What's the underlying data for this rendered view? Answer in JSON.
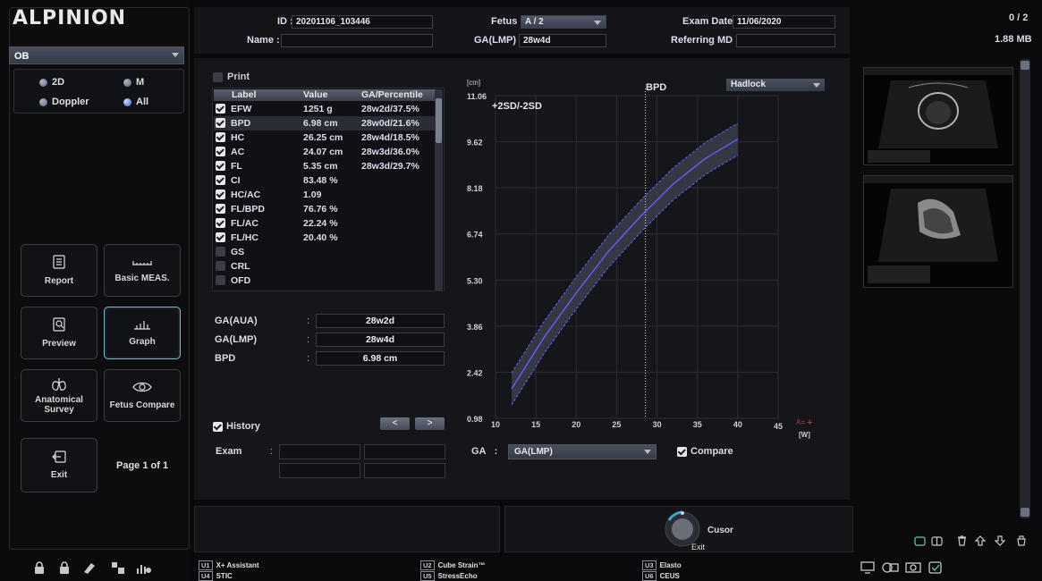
{
  "brand": "ALPINION",
  "app_selector": {
    "value": "OB"
  },
  "modes": [
    {
      "label": "2D",
      "on": false
    },
    {
      "label": "M",
      "on": false
    },
    {
      "label": "Doppler",
      "on": false
    },
    {
      "label": "All",
      "on": true
    }
  ],
  "tools": [
    {
      "label": "Report",
      "icon": "report-icon",
      "active": false
    },
    {
      "label": "Basic MEAS.",
      "icon": "ruler-icon",
      "active": false
    },
    {
      "label": "Preview",
      "icon": "preview-icon",
      "active": false
    },
    {
      "label": "Graph",
      "icon": "graph-icon",
      "active": true
    },
    {
      "label": "Anatomical Survey",
      "icon": "lungs-icon",
      "active": false
    },
    {
      "label": "Fetus Compare",
      "icon": "fetus-icon",
      "active": false
    }
  ],
  "exit_label": "Exit",
  "page_label": "Page 1 of 1",
  "header": {
    "id_label": "ID :",
    "id_value": "20201106_103446",
    "name_label": "Name :",
    "name_value": "",
    "fetus_label": "Fetus :",
    "fetus_value": "A / 2",
    "galmp_label": "GA(LMP) :",
    "galmp_value": "28w4d",
    "exam_date_label": "Exam Date :",
    "exam_date_value": "11/06/2020",
    "ref_md_label": "Referring MD :",
    "ref_md_value": ""
  },
  "print_label": "Print",
  "table": {
    "headers": [
      "Label",
      "Value",
      "GA/Percentile"
    ],
    "rows": [
      {
        "label": "EFW",
        "value": "1251 g",
        "ga": "28w2d/37.5%",
        "checked": true
      },
      {
        "label": "BPD",
        "value": "6.98 cm",
        "ga": "28w0d/21.6%",
        "checked": true
      },
      {
        "label": "HC",
        "value": "26.25 cm",
        "ga": "28w4d/18.5%",
        "checked": true
      },
      {
        "label": "AC",
        "value": "24.07 cm",
        "ga": "28w3d/36.0%",
        "checked": true
      },
      {
        "label": "FL",
        "value": "5.35 cm",
        "ga": "28w3d/29.7%",
        "checked": true
      },
      {
        "label": "CI",
        "value": "83.48 %",
        "ga": "",
        "checked": true
      },
      {
        "label": "HC/AC",
        "value": "1.09",
        "ga": "",
        "checked": true
      },
      {
        "label": "FL/BPD",
        "value": "76.76 %",
        "ga": "",
        "checked": true
      },
      {
        "label": "FL/AC",
        "value": "22.24 %",
        "ga": "",
        "checked": true
      },
      {
        "label": "FL/HC",
        "value": "20.40 %",
        "ga": "",
        "checked": true
      },
      {
        "label": "GS",
        "value": "",
        "ga": "",
        "checked": false
      },
      {
        "label": "CRL",
        "value": "",
        "ga": "",
        "checked": false
      },
      {
        "label": "OFD",
        "value": "",
        "ga": "",
        "checked": false
      }
    ]
  },
  "summary": [
    {
      "label": "GA(AUA)",
      "value": "28w2d"
    },
    {
      "label": "GA(LMP)",
      "value": "28w4d"
    },
    {
      "label": "BPD",
      "value": "6.98 cm"
    }
  ],
  "history_label": "History",
  "nav_prev": "<",
  "nav_next": ">",
  "exam_label": "Exam",
  "ga_label": "GA",
  "ga_select": "GA(LMP)",
  "compare_label": "Compare",
  "chart_data": {
    "type": "line",
    "title": "BPD",
    "method": "Hadlock",
    "band_label": "+2SD/-2SD",
    "ylabel": "[cm]",
    "xlabel": "[W]",
    "xlim": [
      10,
      45
    ],
    "ylim": [
      0.98,
      11.06
    ],
    "yticks": [
      "11.06",
      "9.62",
      "8.18",
      "6.74",
      "5.30",
      "3.86",
      "2.42",
      "0.98"
    ],
    "xticks": [
      "10",
      "15",
      "20",
      "25",
      "30",
      "35",
      "40",
      "45"
    ],
    "marker_label": "A=",
    "marker_x": 28.57,
    "series": [
      {
        "name": "mean",
        "x": [
          12,
          16,
          20,
          24,
          28,
          32,
          36,
          40
        ],
        "values": [
          1.9,
          3.5,
          4.9,
          6.2,
          7.3,
          8.3,
          9.1,
          9.7
        ]
      },
      {
        "name": "+2SD",
        "x": [
          12,
          16,
          20,
          24,
          28,
          32,
          36,
          40
        ],
        "values": [
          2.4,
          4.0,
          5.4,
          6.7,
          7.8,
          8.8,
          9.6,
          10.2
        ]
      },
      {
        "name": "-2SD",
        "x": [
          12,
          16,
          20,
          24,
          28,
          32,
          36,
          40
        ],
        "values": [
          1.4,
          3.0,
          4.4,
          5.7,
          6.8,
          7.8,
          8.6,
          9.2
        ]
      }
    ],
    "colors": {
      "mean": "#6b5cff",
      "band": "#3a3e4a"
    }
  },
  "knob": {
    "top": "Cusor",
    "bottom": "Exit"
  },
  "footer_keys": [
    {
      "key": "U1",
      "label": "X+ Assistant"
    },
    {
      "key": "U4",
      "label": "STIC"
    },
    {
      "key": "U2",
      "label": "Cube Strain™"
    },
    {
      "key": "U5",
      "label": "StressEcho"
    },
    {
      "key": "U3",
      "label": "Elasto"
    },
    {
      "key": "U6",
      "label": "CEUS"
    }
  ],
  "right": {
    "count": "0 / 2",
    "size": "1.88 MB"
  }
}
